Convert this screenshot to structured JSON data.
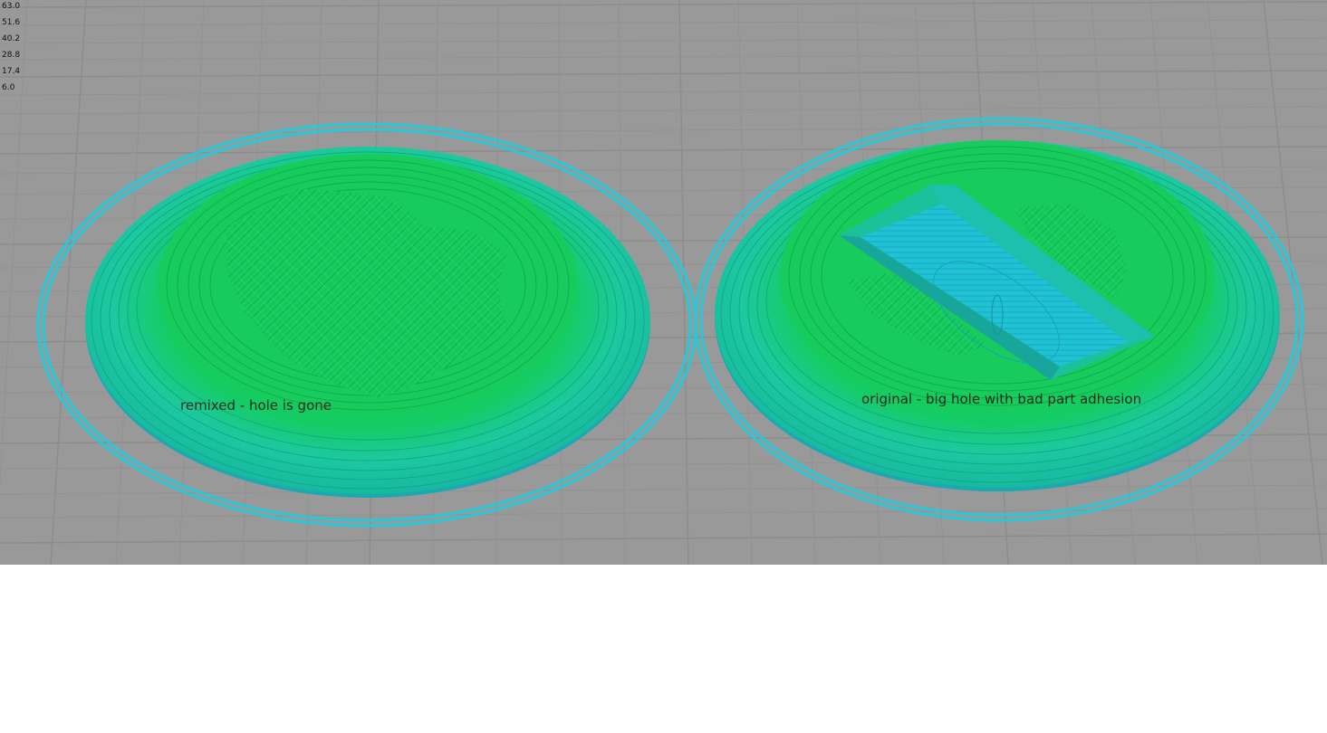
{
  "legend": {
    "ticks": [
      "63.0",
      "51.6",
      "40.2",
      "28.8",
      "17.4",
      "6.0"
    ]
  },
  "annotations": {
    "left": "remixed - hole is gone",
    "right": "original - big hole with bad part adhesion"
  },
  "colors": {
    "bed": "#999999",
    "grid_line": "#8a8a8a",
    "skirt": "#27c9d8",
    "outer_wall": "#19c79a",
    "top_infill": "#13c95a",
    "hole_floor": "#1fc3d4"
  }
}
